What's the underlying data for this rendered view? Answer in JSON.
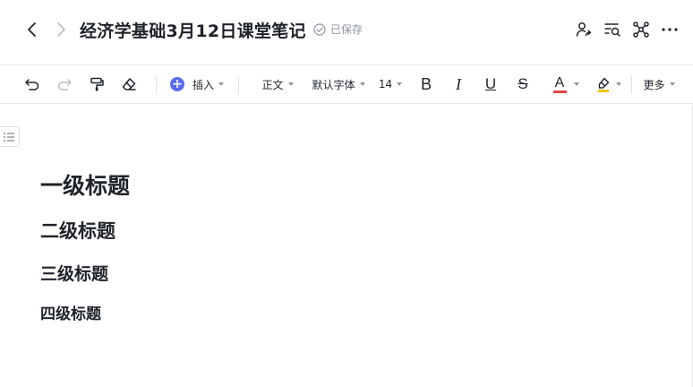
{
  "header": {
    "title": "经济学基础3月12日课堂笔记",
    "save_status": "已保存"
  },
  "toolbar": {
    "insert_label": "插入",
    "style_label": "正文",
    "font_label": "默认字体",
    "size_label": "14",
    "bold_label": "B",
    "italic_label": "I",
    "underline_label": "U",
    "strike_label": "S",
    "font_color_label": "A",
    "more_label": "更多",
    "font_color": "#e54545",
    "highlight_color": "#f5c518",
    "insert_color": "#5b6cf0"
  },
  "document": {
    "h1": "一级标题",
    "h2": "二级标题",
    "h3": "三级标题",
    "h4": "四级标题"
  }
}
